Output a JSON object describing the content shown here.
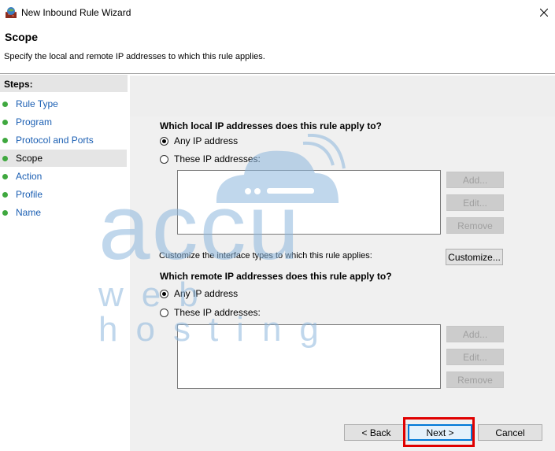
{
  "window": {
    "title": "New Inbound Rule Wizard"
  },
  "header": {
    "title": "Scope",
    "description": "Specify the local and remote IP addresses to which this rule applies."
  },
  "steps": {
    "label": "Steps:",
    "items": [
      {
        "label": "Rule Type"
      },
      {
        "label": "Program"
      },
      {
        "label": "Protocol and Ports"
      },
      {
        "label": "Scope",
        "current": true
      },
      {
        "label": "Action"
      },
      {
        "label": "Profile"
      },
      {
        "label": "Name"
      }
    ],
    "dot_color": "#3fa83f"
  },
  "local": {
    "question": "Which local IP addresses does this rule apply to?",
    "any_label": "Any IP address",
    "these_label": "These IP addresses:",
    "selected": "any",
    "buttons": {
      "add": "Add...",
      "edit": "Edit...",
      "remove": "Remove"
    }
  },
  "interface": {
    "text": "Customize the interface types to which this rule applies:",
    "button": "Customize..."
  },
  "remote": {
    "question": "Which remote IP addresses does this rule apply to?",
    "any_label": "Any IP address",
    "these_label": "These IP addresses:",
    "selected": "any",
    "buttons": {
      "add": "Add...",
      "edit": "Edit...",
      "remove": "Remove"
    }
  },
  "footer": {
    "back": "< Back",
    "next": "Next >",
    "cancel": "Cancel"
  },
  "watermark": {
    "logo": "accu",
    "tagline": "web hosting",
    "color": "#8db7dd"
  },
  "highlight_color": "#e00000"
}
